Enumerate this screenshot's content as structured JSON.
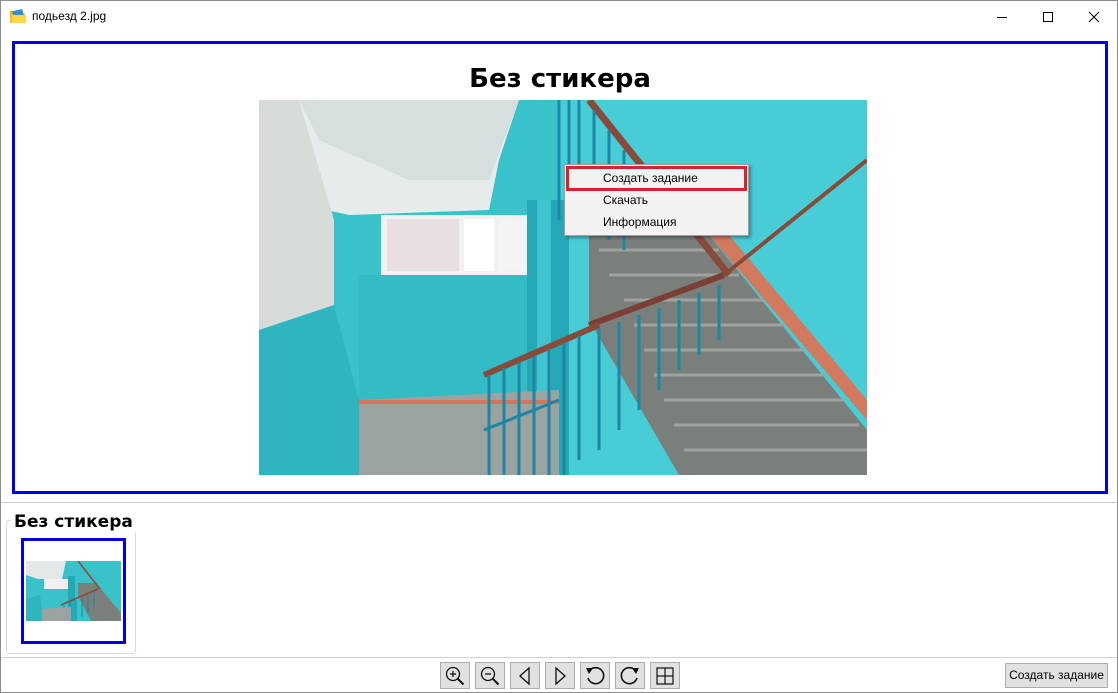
{
  "window": {
    "title": "подьезд 2.jpg",
    "icon": "folder-images-icon"
  },
  "viewer": {
    "title": "Без стикера"
  },
  "context_menu": {
    "items": [
      {
        "label": "Создать задание",
        "highlighted": true
      },
      {
        "label": "Скачать"
      },
      {
        "label": "Информация"
      }
    ]
  },
  "thumbnails": {
    "group_label": "Без стикера"
  },
  "toolbar": {
    "buttons": [
      "zoom-in-icon",
      "zoom-out-icon",
      "prev-icon",
      "next-icon",
      "rotate-left-icon",
      "rotate-right-icon",
      "fit-window-icon"
    ],
    "create_label": "Создать задание"
  },
  "colors": {
    "selection_border": "#0000e6",
    "highlight_border": "#d9232a"
  }
}
